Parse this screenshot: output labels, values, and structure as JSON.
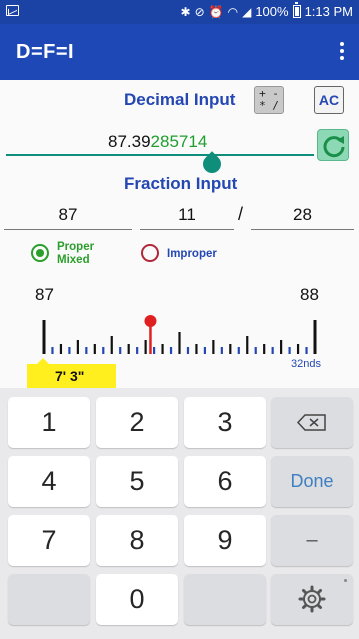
{
  "status_bar": {
    "battery": "100%",
    "time": "1:13 PM",
    "icons": [
      "email-icon",
      "bluetooth-icon",
      "mute-icon",
      "alarm-icon",
      "wifi-icon",
      "signal-icon",
      "battery-icon"
    ]
  },
  "app_bar": {
    "title": "D=F=I"
  },
  "decimal": {
    "title": "Decimal Input",
    "ops_label_top": "+ -",
    "ops_label_bottom": "* /",
    "ac_label": "AC",
    "value_whole": "87.39",
    "value_repeat": "285714"
  },
  "fraction": {
    "title": "Fraction Input",
    "whole": "87",
    "numerator": "11",
    "slash": "/",
    "denominator": "28"
  },
  "mode": {
    "proper_line1": "Proper",
    "proper_line2": "Mixed",
    "improper": "Improper",
    "selected": "proper"
  },
  "ruler": {
    "left_label": "87",
    "right_label": "88",
    "unit": "32nds",
    "marker_fraction": 0.39285714,
    "feet_inches": "7' 3\""
  },
  "keyboard": {
    "keys": [
      "1",
      "2",
      "3",
      "4",
      "5",
      "6",
      "7",
      "8",
      "9",
      "0"
    ],
    "done": "Done",
    "minus": "–"
  },
  "colors": {
    "primary": "#1d48b6",
    "accent": "#0f8e7c",
    "repeat_digits": "#1e9f2e",
    "marker": "#e02020"
  }
}
